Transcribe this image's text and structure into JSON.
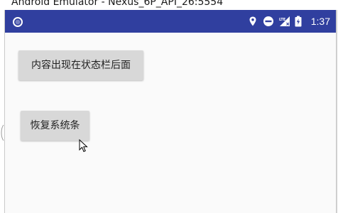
{
  "window": {
    "title": "Android Emulator - Nexus_6P_API_26:5554"
  },
  "status_bar": {
    "background_color": "#303f9f",
    "left_icon": "circle-notification-icon",
    "icons": [
      "location-pin-icon",
      "do-not-disturb-icon",
      "lte-signal-icon",
      "battery-charging-icon"
    ],
    "clock": "1:37"
  },
  "content": {
    "buttons": [
      {
        "label": "内容出现在状态栏后面"
      },
      {
        "label": "恢复系统条"
      }
    ]
  }
}
